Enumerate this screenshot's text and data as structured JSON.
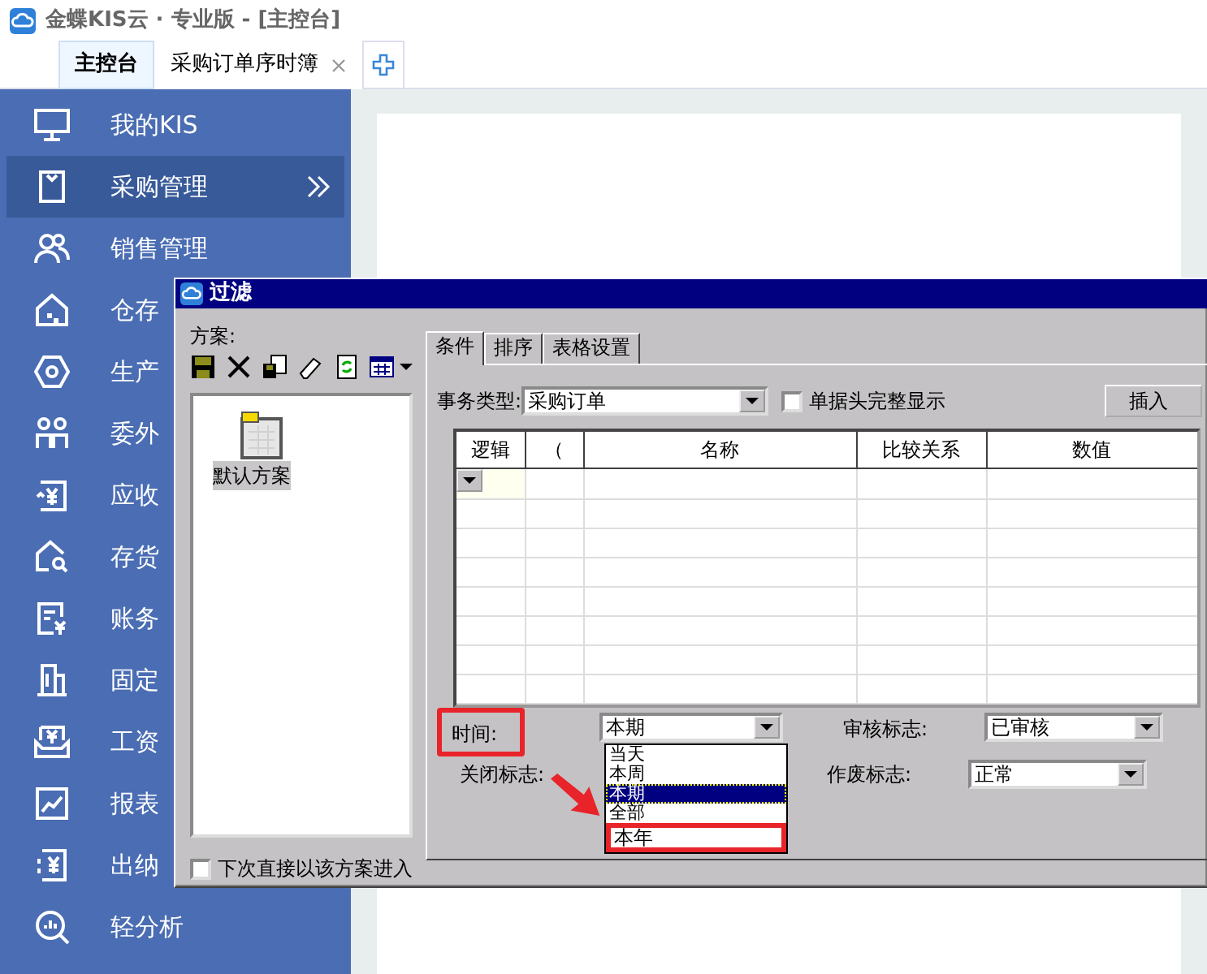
{
  "window": {
    "title": "金蝶KIS云 · 专业版 - [主控台]"
  },
  "tabs": [
    {
      "label": "主控台",
      "selected": true,
      "closable": false
    },
    {
      "label": "采购订单序时簿",
      "selected": false,
      "closable": true
    }
  ],
  "sidebar": {
    "items": [
      {
        "label": "我的KIS",
        "selected": false
      },
      {
        "label": "采购管理",
        "selected": true
      },
      {
        "label": "销售管理",
        "selected": false
      },
      {
        "label": "仓存",
        "selected": false
      },
      {
        "label": "生产",
        "selected": false
      },
      {
        "label": "委外",
        "selected": false
      },
      {
        "label": "应收",
        "selected": false
      },
      {
        "label": "存货",
        "selected": false
      },
      {
        "label": "账务",
        "selected": false
      },
      {
        "label": "固定",
        "selected": false
      },
      {
        "label": "工资",
        "selected": false
      },
      {
        "label": "报表",
        "selected": false
      },
      {
        "label": "出纳",
        "selected": false
      },
      {
        "label": "轻分析",
        "selected": false
      }
    ]
  },
  "dialog": {
    "title": "过滤",
    "scheme_label": "方案:",
    "schemes": [
      {
        "label": "默认方案",
        "selected": true
      }
    ],
    "remember": {
      "label": "下次直接以该方案进入",
      "checked": false
    },
    "tabs": [
      {
        "label": "条件",
        "selected": true
      },
      {
        "label": "排序",
        "selected": false
      },
      {
        "label": "表格设置",
        "selected": false
      }
    ],
    "type_label": "事务类型:",
    "type_value": "采购订单",
    "header_full": {
      "label": "单据头完整显示",
      "checked": false
    },
    "insert_button": "插入",
    "columns": [
      "逻辑",
      "（",
      "名称",
      "比较关系",
      "数值"
    ],
    "time": {
      "label": "时间:",
      "value": "本期",
      "highlighted": true,
      "options": [
        {
          "label": "当天",
          "selected": false,
          "highlighted": false
        },
        {
          "label": "本周",
          "selected": false,
          "highlighted": false
        },
        {
          "label": "本期",
          "selected": true,
          "highlighted": false
        },
        {
          "label": "全部",
          "selected": false,
          "highlighted": false
        },
        {
          "label": "本年",
          "selected": false,
          "highlighted": true
        }
      ]
    },
    "close_flag_label": "关闭标志:",
    "audit": {
      "label": "审核标志:",
      "value": "已审核"
    },
    "void": {
      "label": "作废标志:",
      "value": "正常"
    }
  }
}
